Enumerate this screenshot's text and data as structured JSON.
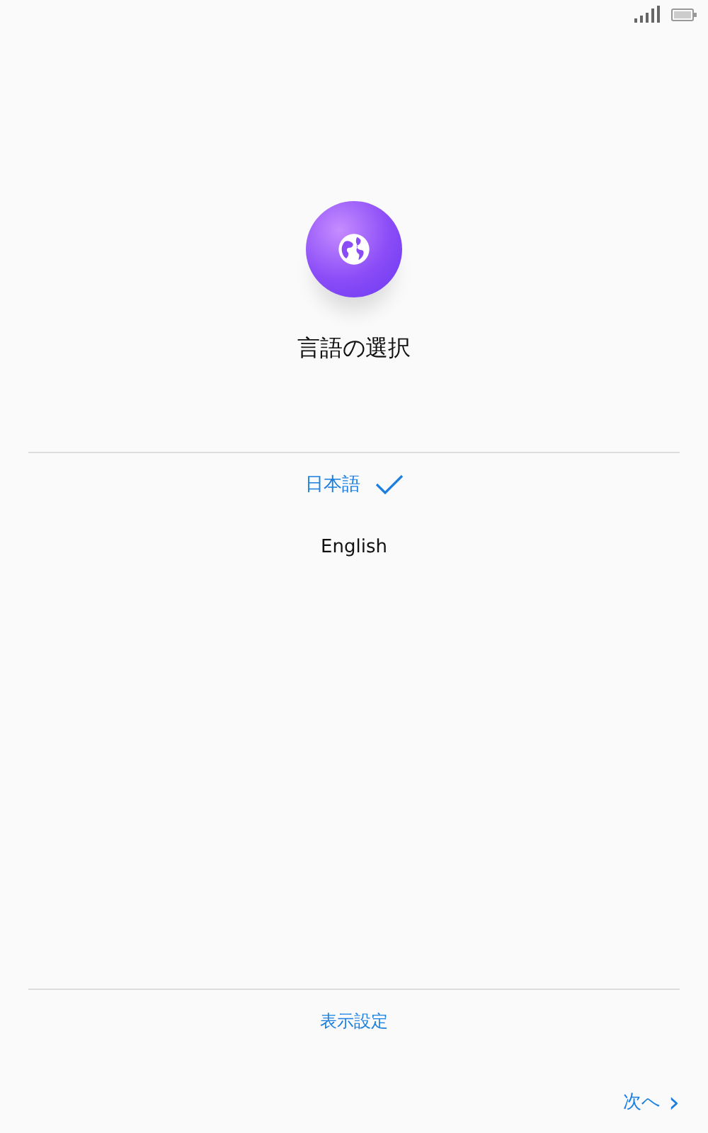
{
  "title": "言語の選択",
  "languages": [
    {
      "label": "日本語",
      "selected": true
    },
    {
      "label": "English",
      "selected": false
    }
  ],
  "display_settings": "表示設定",
  "next": {
    "label": "次へ",
    "arrow": "›"
  }
}
